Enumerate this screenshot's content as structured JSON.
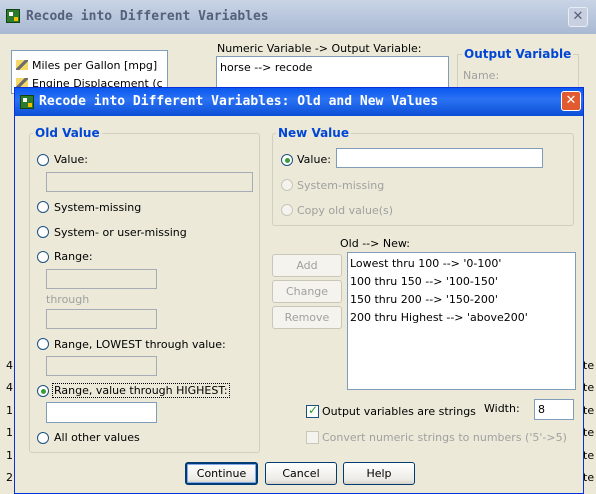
{
  "bg_window": {
    "title": "Recode into Different Variables",
    "close_icon": "close-icon",
    "variables": [
      "Miles per Gallon [mpg]",
      "Engine Displacement (c"
    ],
    "numeric_label": "Numeric Variable -> Output Variable:",
    "numeric_value": "horse --> recode",
    "output_group_title": "Output Variable",
    "name_label": "Name:",
    "left_strip": [
      "4",
      "4",
      "1",
      "1",
      "1",
      "2"
    ],
    "right_strip": [
      "te",
      "te",
      "te",
      "te",
      "te",
      "te"
    ]
  },
  "dialog": {
    "title": "Recode into Different Variables: Old and New Values",
    "close_icon": "close-icon",
    "old_value": {
      "title": "Old Value",
      "value_label": "Value:",
      "value_input": "",
      "system_missing": "System-missing",
      "system_or_user_missing": "System- or user-missing",
      "range_label": "Range:",
      "range_from": "",
      "through": "through",
      "range_to": "",
      "range_lowest": "Range, LOWEST through value:",
      "range_lowest_input": "",
      "range_highest": "Range, value through HIGHEST:",
      "range_highest_input": "",
      "all_other": "All other values",
      "selected": "range_highest"
    },
    "new_value": {
      "title": "New Value",
      "value_label": "Value:",
      "value_input": "",
      "system_missing": "System-missing",
      "copy_old": "Copy old value(s)",
      "selected": "value"
    },
    "old_new_label": "Old --> New:",
    "mappings": [
      "Lowest thru 100 --> '0-100'",
      "100 thru 150 --> '100-150'",
      "150 thru 200 --> '150-200'",
      "200 thru Highest --> 'above200'"
    ],
    "buttons": {
      "add": "Add",
      "change": "Change",
      "remove": "Remove",
      "continue": "Continue",
      "cancel": "Cancel",
      "help": "Help"
    },
    "output_strings": {
      "label": "Output variables are strings",
      "checked": true
    },
    "width_label": "Width:",
    "width_value": "8",
    "convert_numeric": {
      "label": "Convert numeric strings to numbers ('5'->5)",
      "checked": false
    }
  }
}
